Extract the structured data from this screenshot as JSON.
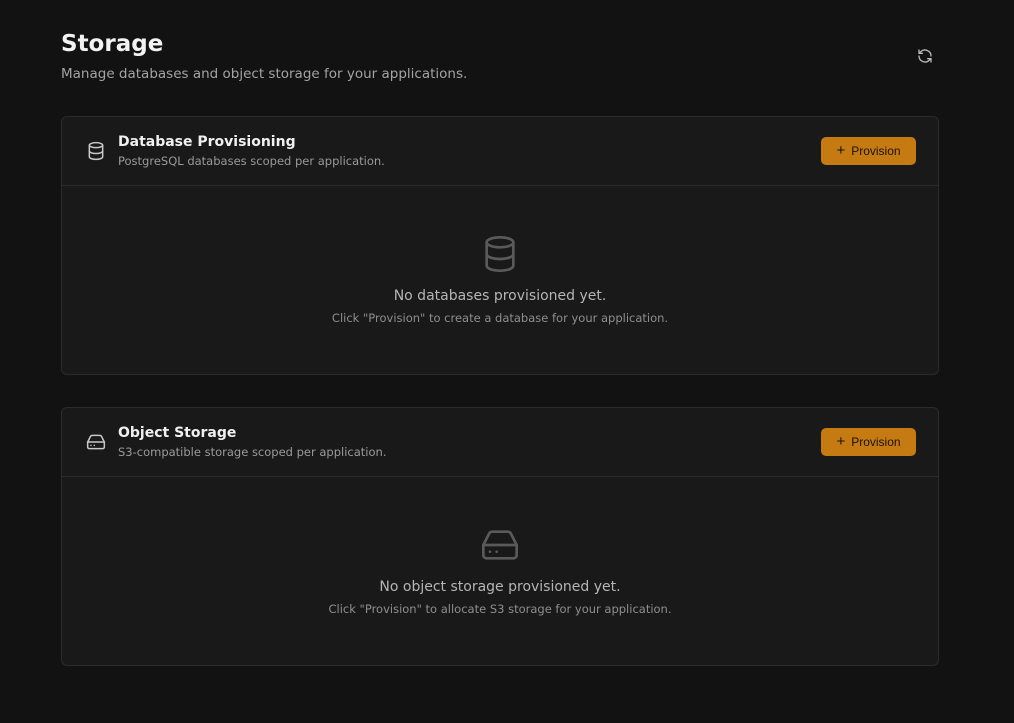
{
  "header": {
    "title": "Storage",
    "subtitle": "Manage databases and object storage for your applications.",
    "refresh_icon": "refresh-icon"
  },
  "colors": {
    "background": "#121212",
    "card": "#191919",
    "accent": "#c57a12"
  },
  "database": {
    "icon": "database-icon",
    "title": "Database Provisioning",
    "description": "PostgreSQL databases scoped per application.",
    "button_icon": "plus-icon",
    "button_label": "Provision",
    "empty_title": "No databases provisioned yet.",
    "empty_description": "Click \"Provision\" to create a database for your application."
  },
  "object_storage": {
    "icon": "hard-drive-icon",
    "title": "Object Storage",
    "description": "S3-compatible storage scoped per application.",
    "button_icon": "plus-icon",
    "button_label": "Provision",
    "empty_title": "No object storage provisioned yet.",
    "empty_description": "Click \"Provision\" to allocate S3 storage for your application."
  }
}
